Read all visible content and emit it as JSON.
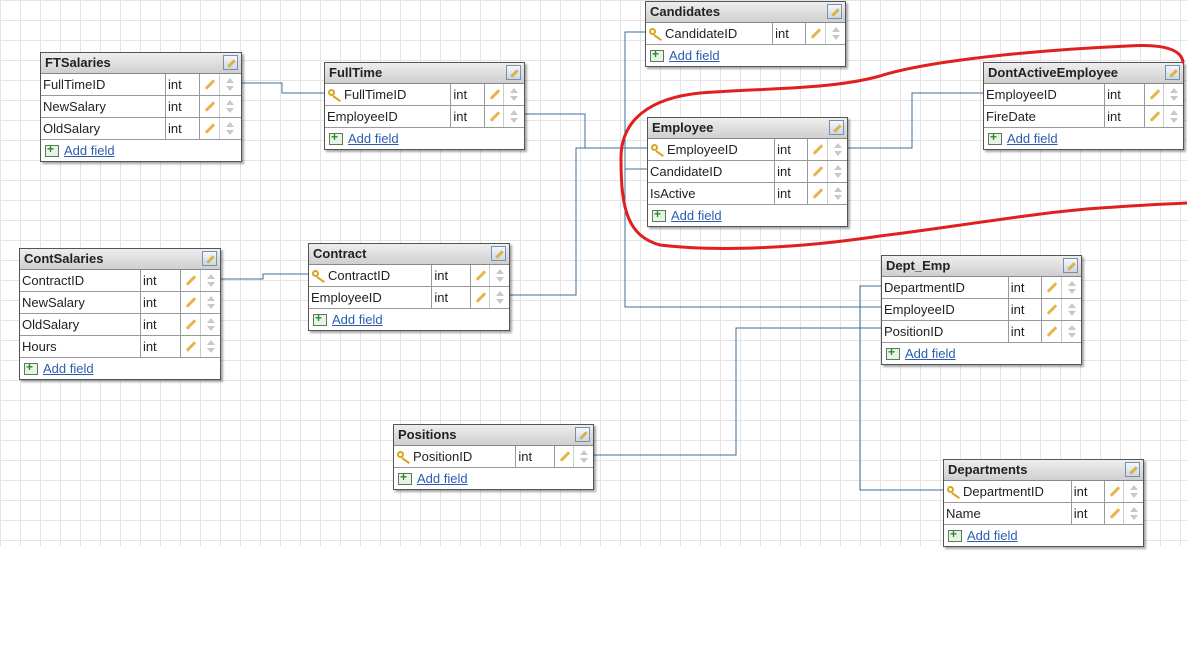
{
  "accent_link_color": "#2a5db0",
  "highlight_color": "#e02020",
  "add_field_label": "Add field",
  "tables": [
    {
      "id": "ftsalaries",
      "name": "FTSalaries",
      "fields": [
        {
          "name": "FullTimeID",
          "type": "int",
          "pk": false
        },
        {
          "name": "NewSalary",
          "type": "int",
          "pk": false
        },
        {
          "name": "OldSalary",
          "type": "int",
          "pk": false
        }
      ]
    },
    {
      "id": "fulltime",
      "name": "FullTime",
      "fields": [
        {
          "name": "FullTimeID",
          "type": "int",
          "pk": true
        },
        {
          "name": "EmployeeID",
          "type": "int",
          "pk": false
        }
      ]
    },
    {
      "id": "candidates",
      "name": "Candidates",
      "fields": [
        {
          "name": "CandidateID",
          "type": "int",
          "pk": true
        }
      ]
    },
    {
      "id": "employee",
      "name": "Employee",
      "fields": [
        {
          "name": "EmployeeID",
          "type": "int",
          "pk": true
        },
        {
          "name": "CandidateID",
          "type": "int",
          "pk": false
        },
        {
          "name": "IsActive",
          "type": "int",
          "pk": false
        }
      ]
    },
    {
      "id": "dontactive",
      "name": "DontActiveEmployee",
      "fields": [
        {
          "name": "EmployeeID",
          "type": "int",
          "pk": false
        },
        {
          "name": "FireDate",
          "type": "int",
          "pk": false
        }
      ]
    },
    {
      "id": "contsalaries",
      "name": "ContSalaries",
      "fields": [
        {
          "name": "ContractID",
          "type": "int",
          "pk": false
        },
        {
          "name": "NewSalary",
          "type": "int",
          "pk": false
        },
        {
          "name": "OldSalary",
          "type": "int",
          "pk": false
        },
        {
          "name": "Hours",
          "type": "int",
          "pk": false
        }
      ]
    },
    {
      "id": "contract",
      "name": "Contract",
      "fields": [
        {
          "name": "ContractID",
          "type": "int",
          "pk": true
        },
        {
          "name": "EmployeeID",
          "type": "int",
          "pk": false
        }
      ]
    },
    {
      "id": "deptemp",
      "name": "Dept_Emp",
      "fields": [
        {
          "name": "DepartmentID",
          "type": "int",
          "pk": false
        },
        {
          "name": "EmployeeID",
          "type": "int",
          "pk": false
        },
        {
          "name": "PositionID",
          "type": "int",
          "pk": false
        }
      ]
    },
    {
      "id": "positions",
      "name": "Positions",
      "fields": [
        {
          "name": "PositionID",
          "type": "int",
          "pk": true
        }
      ]
    },
    {
      "id": "departments",
      "name": "Departments",
      "fields": [
        {
          "name": "DepartmentID",
          "type": "int",
          "pk": true
        },
        {
          "name": "Name",
          "type": "int",
          "pk": false
        }
      ]
    }
  ]
}
